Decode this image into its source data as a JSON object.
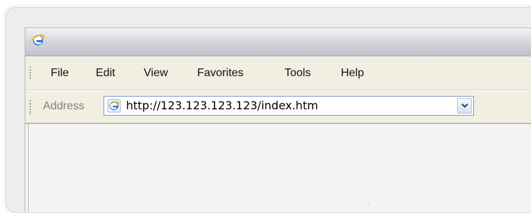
{
  "menu": {
    "items": [
      {
        "label": "File"
      },
      {
        "label": "Edit"
      },
      {
        "label": "View"
      },
      {
        "label": "Favorites"
      },
      {
        "label": "Tools"
      },
      {
        "label": "Help"
      }
    ]
  },
  "address_bar": {
    "label": "Address",
    "url": "http://123.123.123.123/index.htm"
  },
  "icons": {
    "window_icon": "internet-explorer-icon",
    "page_icon": "internet-explorer-page-icon",
    "dropdown_icon": "chevron-down-icon"
  },
  "colors": {
    "field_border": "#7f9db9",
    "menu_bg": "#f1efe2",
    "content_bg": "#f2f1ef",
    "ie_blue": "#2f6fd6"
  }
}
